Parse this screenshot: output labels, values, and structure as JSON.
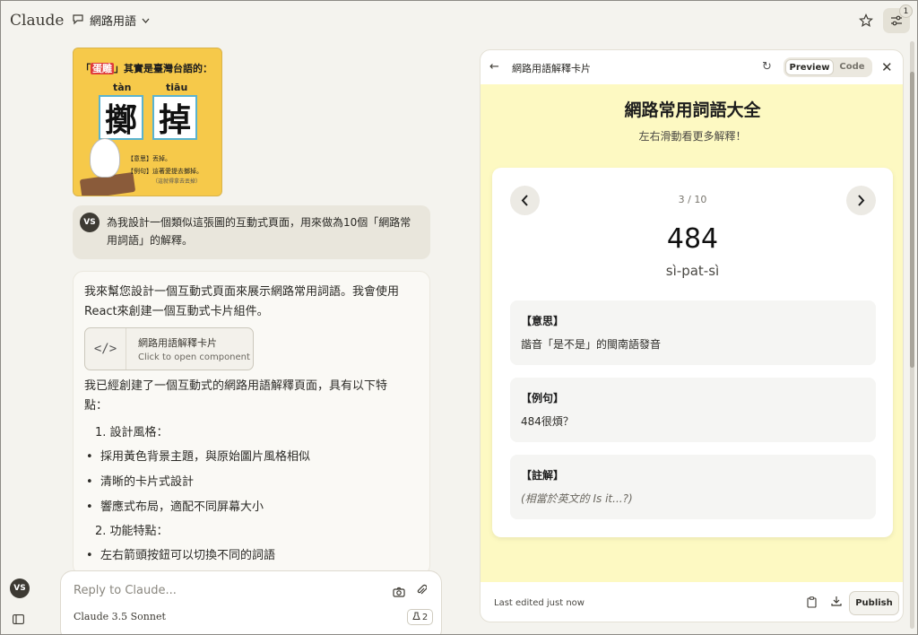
{
  "app": {
    "logo": "Claude"
  },
  "header": {
    "conversation_title": "網路用語",
    "settings_badge": "1"
  },
  "image_card": {
    "headline_prefix": "「",
    "headline_highlight": "蛋雕",
    "headline_rest": "」其實是臺灣台語的：",
    "pinyin_left": "tàn",
    "pinyin_right": "tiāu",
    "char_left": "擲",
    "char_right": "掉",
    "meaning": "【意思】丟掉。",
    "example": "【例句】這著愛提去擲掉。",
    "example_note": "（這就得拿去丟掉）"
  },
  "user_message": {
    "avatar": "VS",
    "text": "為我設計一個類似這張圖的互動式頁面，用來做為10個「網路常用詞語」的解釋。"
  },
  "assistant_message": {
    "intro": "我來幫您設計一個互動式頁面來展示網路常用詞語。我會使用React來創建一個互動式卡片組件。",
    "artifact_icon": "</>",
    "artifact_title": "網路用語解釋卡片",
    "artifact_subtitle": "Click to open component",
    "summary": "我已經創建了一個互動式的網路用語解釋頁面，具有以下特點：",
    "list": [
      "1. 設計風格：",
      "採用黃色背景主題，與原始圖片風格相似",
      "清晰的卡片式設計",
      "響應式布局，適配不同屏幕大小",
      "2. 功能特點：",
      "左右箭頭按鈕可以切換不同的詞語"
    ]
  },
  "composer": {
    "placeholder": "Reply to Claude...",
    "model": "Claude 3.5 Sonnet",
    "attachments_count": "2"
  },
  "sidebar": {
    "user_avatar": "VS"
  },
  "artifact_panel": {
    "title": "網路用語解釋卡片",
    "tab_preview": "Preview",
    "tab_code": "Code",
    "page_title": "網路常用詞語大全",
    "page_subtitle": "左右滑動看更多解釋！",
    "counter": "3 / 10",
    "term": "484",
    "pronunciation": "sì-pat-sì",
    "sections": [
      {
        "label": "【意思】",
        "value": "諧音「是不是」的閩南語發音"
      },
      {
        "label": "【例句】",
        "value": "484很煩？"
      },
      {
        "label": "【註解】",
        "value": "(相當於英文的 Is it...?)"
      }
    ],
    "footer_status": "Last edited just now",
    "publish_label": "Publish"
  },
  "colors": {
    "page_bg": "#f4f3ee",
    "artifact_yellow": "#fdf9c2",
    "image_yellow": "#f6c94a"
  }
}
